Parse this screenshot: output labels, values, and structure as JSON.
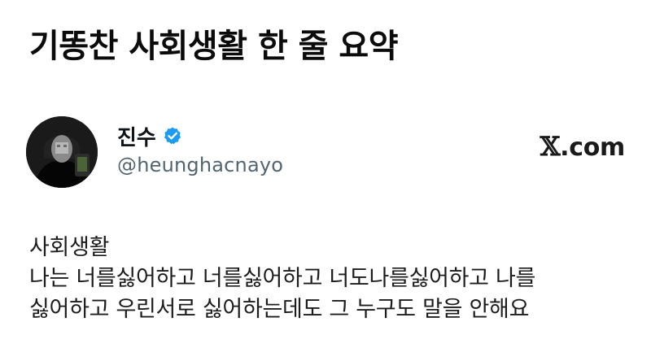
{
  "headline": "기똥찬 사회생활 한 줄 요약",
  "tweet": {
    "author": {
      "display_name": "진수",
      "handle": "@heunghacnayo",
      "verified": true,
      "avatar_icon": "profile-photo",
      "verified_icon": "verified-badge-icon"
    },
    "source": {
      "x_mark": "𝕏",
      "domain": ".com"
    },
    "body_lines": [
      "사회생활",
      "나는 너를싫어하고 너를싫어하고 너도나를싫어하고 나를",
      "싫어하고 우린서로 싫어하는데도 그 누구도 말을 안해요"
    ]
  },
  "colors": {
    "verified_blue": "#1d9bf0",
    "handle_gray": "#536471",
    "text": "#111111"
  }
}
